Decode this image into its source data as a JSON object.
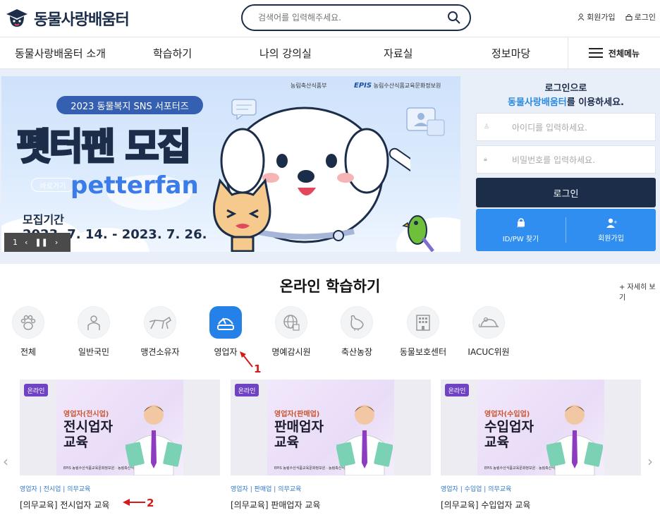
{
  "header": {
    "logo_text": "동물사랑배움터",
    "search_placeholder": "검색어를 입력해주세요.",
    "signup_label": "회원가입",
    "login_label": "로그인"
  },
  "gnb": {
    "items": [
      "동물사랑배움터 소개",
      "학습하기",
      "나의 강의실",
      "자료실",
      "정보마당"
    ],
    "all_menu_label": "전체메뉴"
  },
  "banner": {
    "org1": "농림축산식품부",
    "org2": "농림수산식품교육문화정보원",
    "org2_logo": "EPIS",
    "subtitle": "2023 동물복지 SNS 서포터즈",
    "title": "펫터팬 모집",
    "title_en": "petterfan",
    "shortcut_label": "바로가기",
    "period_label": "모집기간",
    "period": "2023. 7. 14. - 2023. 7. 26.",
    "pager": "1"
  },
  "login_box": {
    "line1": "로그인으로",
    "line2_highlight": "동물사랑배움터",
    "line2_rest": "를 이용하세요.",
    "id_placeholder": "아이디를 입력하세요.",
    "pw_placeholder": "비밀번호를 입력하세요.",
    "login_button": "로그인",
    "find_label": "ID/PW 찾기",
    "signup_label": "회원가입"
  },
  "online": {
    "title": "온라인 학습하기",
    "more": "+ 자세히 보기",
    "categories": [
      "전체",
      "일반국민",
      "맹견소유자",
      "영업자",
      "명예감시원",
      "축산농장",
      "동물보호센터",
      "IACUC위원"
    ],
    "active_category": "영업자"
  },
  "cards": [
    {
      "badge": "온라인",
      "sub": "영업자(전시업)",
      "title1": "전시업자",
      "title2": "교육",
      "tags": "영업자 | 전시업 | 의무교육",
      "name": "[의무교육] 전시업자 교육",
      "orgs": "EPIS 농림수산식품교육문화정보원 · 농림축산식품부"
    },
    {
      "badge": "온라인",
      "sub": "영업자(판매업)",
      "title1": "판매업자",
      "title2": "교육",
      "tags": "영업자 | 판매업 | 의무교육",
      "name": "[의무교육] 판매업자 교육",
      "orgs": "EPIS 농림수산식품교육문화정보원 · 농림축산식품부"
    },
    {
      "badge": "온라인",
      "sub": "영업자(수입업)",
      "title1": "수입업자",
      "title2": "교육",
      "tags": "영업자 | 수입업 | 의무교육",
      "name": "[의무교육] 수입업자 교육",
      "orgs": "EPIS 농림수산식품교육문화정보원 · 농림축산식품부"
    }
  ],
  "annotations": {
    "marker1": "1",
    "marker2": "2"
  },
  "colors": {
    "navy": "#1c2d4a",
    "blue": "#2f8ef0",
    "purple": "#7043c4",
    "red": "#d41a1a"
  }
}
